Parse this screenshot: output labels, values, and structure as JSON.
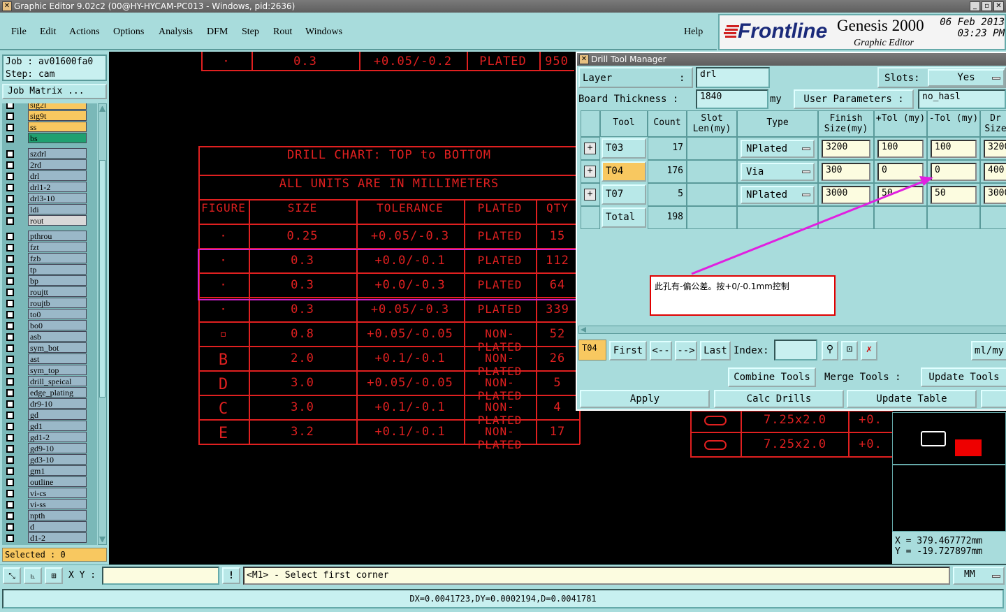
{
  "window": {
    "title": "Graphic Editor 9.02c2 (00@HY-HYCAM-PC013 - Windows, pid:2636)"
  },
  "menu": {
    "items": [
      "File",
      "Edit",
      "Actions",
      "Options",
      "Analysis",
      "DFM",
      "Step",
      "Rout",
      "Windows"
    ],
    "help": "Help"
  },
  "branding": {
    "logo": "Frontline",
    "product": "Genesis 2000",
    "subtitle": "Graphic Editor",
    "date": "06 Feb 2013",
    "time": "03:23 PM"
  },
  "job": {
    "job_label": "Job : av01600fa0",
    "step_label": "Step: cam",
    "matrix_button": "Job Matrix ..."
  },
  "layers": [
    {
      "name": "sig2l",
      "color": "#f8c860"
    },
    {
      "name": "sig9t",
      "color": "#f8c860"
    },
    {
      "name": "ss",
      "color": "#f8c860"
    },
    {
      "name": "bs",
      "color": "#20a070"
    },
    {
      "name": "szdrl",
      "color": "#9ab8c8"
    },
    {
      "name": "2rd",
      "color": "#9ab8c8"
    },
    {
      "name": "drl",
      "color": "#9ab8c8"
    },
    {
      "name": "drl1-2",
      "color": "#9ab8c8"
    },
    {
      "name": "drl3-10",
      "color": "#9ab8c8"
    },
    {
      "name": "ldi",
      "color": "#9ab8c8"
    },
    {
      "name": "rout",
      "color": "#d8d8d8"
    },
    {
      "name": "pthrou",
      "color": "#9ab8c8"
    },
    {
      "name": "fzt",
      "color": "#9ab8c8"
    },
    {
      "name": "fzb",
      "color": "#9ab8c8"
    },
    {
      "name": "tp",
      "color": "#9ab8c8"
    },
    {
      "name": "bp",
      "color": "#9ab8c8"
    },
    {
      "name": "roujtt",
      "color": "#9ab8c8"
    },
    {
      "name": "roujtb",
      "color": "#9ab8c8"
    },
    {
      "name": "to0",
      "color": "#9ab8c8"
    },
    {
      "name": "bo0",
      "color": "#9ab8c8"
    },
    {
      "name": "asb",
      "color": "#9ab8c8"
    },
    {
      "name": "sym_bot",
      "color": "#9ab8c8"
    },
    {
      "name": "ast",
      "color": "#9ab8c8"
    },
    {
      "name": "sym_top",
      "color": "#9ab8c8"
    },
    {
      "name": "drill_speical",
      "color": "#9ab8c8"
    },
    {
      "name": "edge_plating",
      "color": "#9ab8c8"
    },
    {
      "name": "dr9-10",
      "color": "#9ab8c8"
    },
    {
      "name": "gd",
      "color": "#9ab8c8"
    },
    {
      "name": "gd1",
      "color": "#9ab8c8"
    },
    {
      "name": "gd1-2",
      "color": "#9ab8c8"
    },
    {
      "name": "gd9-10",
      "color": "#9ab8c8"
    },
    {
      "name": "gd3-10",
      "color": "#9ab8c8"
    },
    {
      "name": "gm1",
      "color": "#9ab8c8"
    },
    {
      "name": "outline",
      "color": "#9ab8c8"
    },
    {
      "name": "vi-cs",
      "color": "#9ab8c8"
    },
    {
      "name": "vi-ss",
      "color": "#9ab8c8"
    },
    {
      "name": "npth",
      "color": "#9ab8c8"
    },
    {
      "name": "d",
      "color": "#9ab8c8"
    },
    {
      "name": "d1-2",
      "color": "#9ab8c8"
    }
  ],
  "selected_label": "Selected : 0",
  "drill_chart": {
    "top_row": {
      "figure": "·",
      "size": "0.3",
      "tol": "+0.05/-0.2",
      "plated": "PLATED",
      "qty": "950"
    },
    "title": "DRILL CHART: TOP to BOTTOM",
    "units": "ALL UNITS ARE IN MILLIMETERS",
    "headers": [
      "FIGURE",
      "SIZE",
      "TOLERANCE",
      "PLATED",
      "QTY"
    ],
    "rows": [
      {
        "figure": "·",
        "size": "0.25",
        "tol": "+0.05/-0.3",
        "plated": "PLATED",
        "qty": "15"
      },
      {
        "figure": "·",
        "size": "0.3",
        "tol": "+0.0/-0.1",
        "plated": "PLATED",
        "qty": "112"
      },
      {
        "figure": "·",
        "size": "0.3",
        "tol": "+0.0/-0.3",
        "plated": "PLATED",
        "qty": "64"
      },
      {
        "figure": "·",
        "size": "0.3",
        "tol": "+0.05/-0.3",
        "plated": "PLATED",
        "qty": "339"
      },
      {
        "figure": "▫",
        "size": "0.8",
        "tol": "+0.05/-0.05",
        "plated": "NON-PLATED",
        "qty": "52"
      },
      {
        "figure": "B",
        "size": "2.0",
        "tol": "+0.1/-0.1",
        "plated": "NON-PLATED",
        "qty": "26"
      },
      {
        "figure": "D",
        "size": "3.0",
        "tol": "+0.05/-0.05",
        "plated": "NON-PLATED",
        "qty": "5"
      },
      {
        "figure": "C",
        "size": "3.0",
        "tol": "+0.1/-0.1",
        "plated": "NON-PLATED",
        "qty": "4"
      },
      {
        "figure": "E",
        "size": "3.2",
        "tol": "+0.1/-0.1",
        "plated": "NON-PLATED",
        "qty": "17"
      }
    ],
    "slot_rows": [
      {
        "size": "7.25x2.0",
        "tol": "+0."
      },
      {
        "size": "7.25x2.0",
        "tol": "+0."
      }
    ]
  },
  "coords": {
    "x": "X  = 379.467772mm",
    "y": "Y  = -19.727897mm"
  },
  "dtm": {
    "title": "Drill Tool Manager",
    "layer_label": "Layer",
    "layer_colon": ":",
    "layer_value": "drl",
    "slots_label": "Slots:",
    "slots_value": "Yes",
    "board_thickness_label": "Board Thickness :",
    "board_thickness_value": "1840",
    "board_thickness_unit": "my",
    "user_params_label": "User Parameters :",
    "user_params_value": "no_hasl",
    "headers": [
      "Tool",
      "Count",
      "Slot Len(my)",
      "Type",
      "Finish Size(my)",
      "+Tol (my)",
      "-Tol (my)",
      "Dr Size"
    ],
    "rows": [
      {
        "tool": "T03",
        "count": "17",
        "type": "NPlated",
        "finish": "3200",
        "ptol": "100",
        "mtol": "100",
        "drill": "3200"
      },
      {
        "tool": "T04",
        "count": "176",
        "type": "Via",
        "finish": "300",
        "ptol": "0",
        "mtol": "0",
        "drill": "400"
      },
      {
        "tool": "T07",
        "count": "5",
        "type": "NPlated",
        "finish": "3000",
        "ptol": "50",
        "mtol": "50",
        "drill": "3000"
      }
    ],
    "total_label": "Total",
    "total_count": "198",
    "annotation": "此孔有-偏公差。按+0/-0.1mm控制",
    "current_tool": "T04",
    "nav": {
      "first": "First",
      "prev": "<--",
      "next": "-->",
      "last": "Last",
      "index_label": "Index:",
      "units": "ml/my"
    },
    "combine": "Combine Tools",
    "merge": "Merge Tools :",
    "update": "Update Tools",
    "apply": "Apply",
    "calc": "Calc Drills",
    "update_table": "Update Table"
  },
  "statusbar": {
    "xy_label": "X Y :",
    "xy_value": "",
    "prompt": "<M1> - Select first corner",
    "units": "MM",
    "delta": "DX=0.0041723,DY=0.0002194,D=0.0041781"
  }
}
